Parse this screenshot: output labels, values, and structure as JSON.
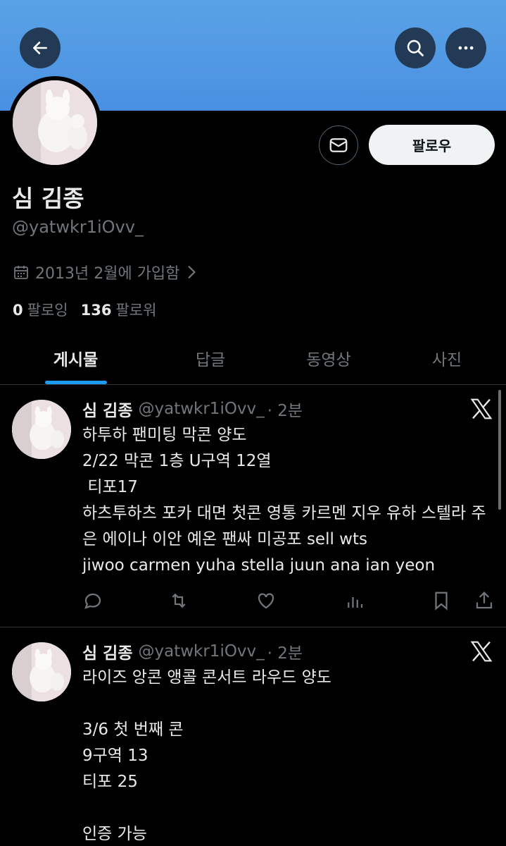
{
  "header": {
    "back_icon": "arrow-left-icon",
    "search_icon": "search-icon",
    "more_icon": "more-horizontal-icon",
    "banner_color": "#4a90e2"
  },
  "profile": {
    "display_name": "심 김종",
    "handle": "@yatwkr1iOvv_",
    "joined": "2013년 2월에 가입함",
    "following_count": "0",
    "following_label": "팔로잉",
    "followers_count": "136",
    "followers_label": "팔로워",
    "follow_button": "팔로우",
    "message_icon": "envelope-icon"
  },
  "tabs": [
    {
      "label": "게시물",
      "active": true
    },
    {
      "label": "답글",
      "active": false
    },
    {
      "label": "동영상",
      "active": false
    },
    {
      "label": "사진",
      "active": false
    }
  ],
  "posts": [
    {
      "name": "심 김종",
      "handle": "@yatwkr1iOvv_",
      "time": "· 2분",
      "body": "하투하 팬미팅 막콘 양도\n2/22 막콘 1층 U구역 12열\n 티포17\n하츠투하츠 포카 대면 첫콘 영통 카르멘 지우 유하 스텔라 주은 에이나 이안 예온 팬싸 미공포 sell wts\njiwoo carmen yuha stella juun ana ian yeon"
    },
    {
      "name": "심 김종",
      "handle": "@yatwkr1iOvv_",
      "time": "· 2분",
      "body": "라이즈 앙콘 앵콜 콘서트 라우드 양도\n\n3/6 첫 번째 콘\n9구역 13\n티포 25\n\n인증 가능"
    }
  ]
}
